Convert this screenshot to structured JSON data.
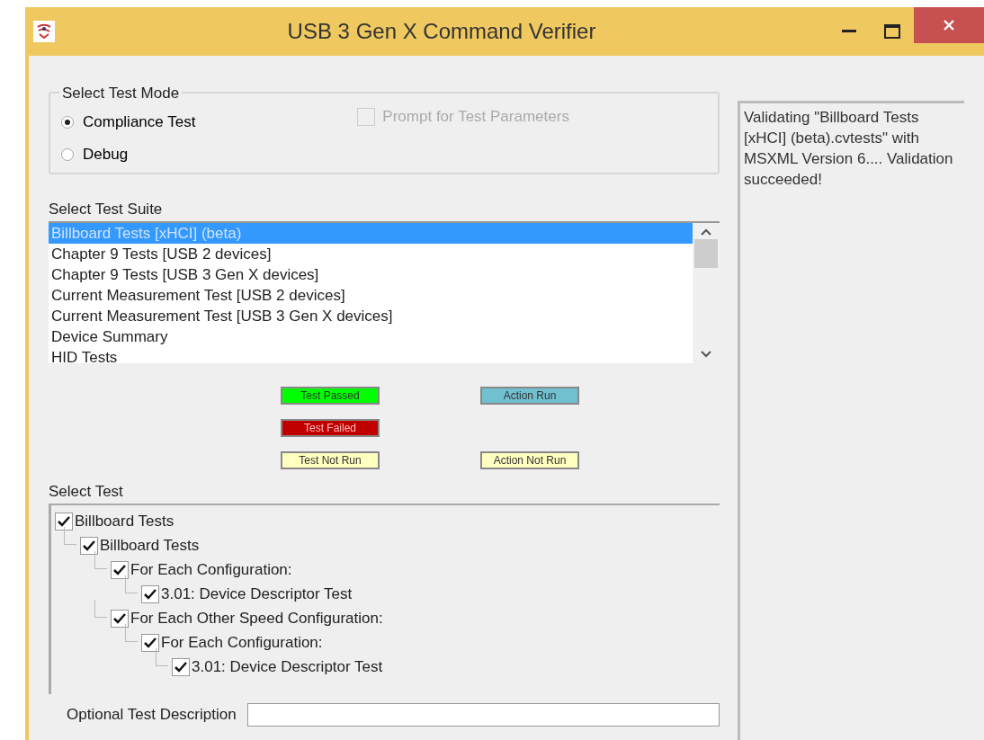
{
  "window": {
    "title": "USB 3 Gen X Command Verifier"
  },
  "test_mode": {
    "label": "Select Test Mode",
    "options": [
      {
        "label": "Compliance Test",
        "selected": true
      },
      {
        "label": "Debug",
        "selected": false
      }
    ],
    "prompt": {
      "label": "Prompt for Test Parameters",
      "checked": false,
      "disabled": true
    }
  },
  "test_suite": {
    "label": "Select Test Suite",
    "items": [
      {
        "label": "Billboard Tests [xHCI] (beta)",
        "selected": true
      },
      {
        "label": "Chapter 9 Tests [USB 2 devices]",
        "selected": false
      },
      {
        "label": "Chapter 9 Tests [USB 3 Gen X devices]",
        "selected": false
      },
      {
        "label": "Current Measurement Test [USB 2 devices]",
        "selected": false
      },
      {
        "label": "Current Measurement Test [USB 3 Gen X devices]",
        "selected": false
      },
      {
        "label": "Device Summary",
        "selected": false
      },
      {
        "label": "HID Tests",
        "selected": false
      }
    ]
  },
  "legend": [
    {
      "items": [
        {
          "label": "Test Passed",
          "color": "#00ff00"
        },
        {
          "label": "Action Run",
          "color": "#70c0d0"
        }
      ]
    },
    {
      "items": [
        {
          "label": "Test Failed",
          "color": "#c00000"
        }
      ]
    },
    {
      "items": [
        {
          "label": "Test Not Run",
          "color": "#ffffc0"
        },
        {
          "label": "Action Not Run",
          "color": "#ffffc0"
        }
      ]
    }
  ],
  "select_test": {
    "label": "Select Test",
    "tree": [
      {
        "label": "Billboard Tests",
        "checked": true,
        "children": [
          {
            "label": "Billboard Tests",
            "checked": true,
            "children": [
              {
                "label": "For Each Configuration:",
                "checked": true,
                "children": [
                  {
                    "label": "3.01: Device Descriptor Test",
                    "checked": true
                  }
                ]
              },
              {
                "label": "For Each Other Speed Configuration:",
                "checked": true,
                "children": [
                  {
                    "label": "For Each Configuration:",
                    "checked": true,
                    "children": [
                      {
                        "label": "3.01: Device Descriptor Test",
                        "checked": true
                      }
                    ]
                  }
                ]
              }
            ]
          }
        ]
      }
    ]
  },
  "description": {
    "label": "Optional Test Description"
  },
  "log": {
    "text": "Validating \"Billboard Tests [xHCI] (beta).cvtests\" with MSXML Version 6.... Validation succeeded!"
  }
}
